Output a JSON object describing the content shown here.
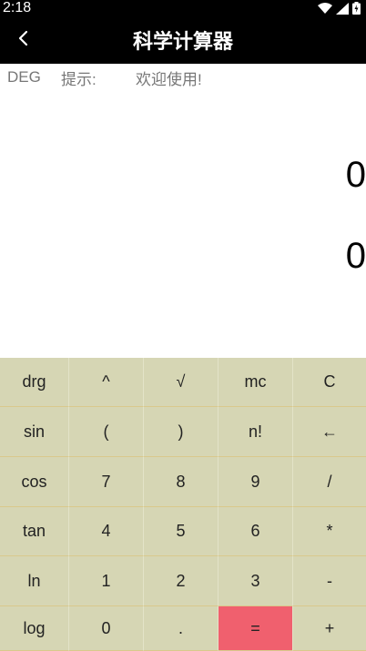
{
  "status_bar": {
    "time": "2:18",
    "icons": [
      "wifi-icon",
      "signal-icon",
      "battery-charging-icon"
    ]
  },
  "app_bar": {
    "title": "科学计算器",
    "back_icon": "chevron-left-icon"
  },
  "info": {
    "mode": "DEG",
    "hint_label": "提示:",
    "hint_text": "欢迎使用!"
  },
  "display": {
    "expression": "0",
    "result": "0"
  },
  "keypad": {
    "keys": [
      "drg",
      "^",
      "√",
      "mc",
      "C",
      "sin",
      "(",
      ")",
      "n!",
      "←",
      "cos",
      "7",
      "8",
      "9",
      "/",
      "tan",
      "4",
      "5",
      "6",
      "*",
      "ln",
      "1",
      "2",
      "3",
      "-",
      "log",
      "0",
      ".",
      "=",
      "+"
    ],
    "equals_color": "#f0606e",
    "background_color": "#d6d6b4"
  }
}
